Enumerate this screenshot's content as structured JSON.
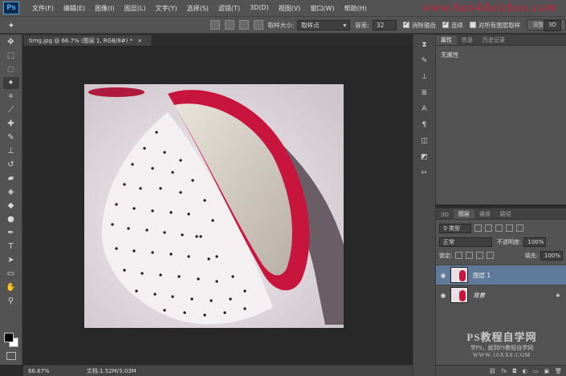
{
  "app": {
    "logo": "Ps"
  },
  "menu": [
    "文件(F)",
    "编辑(E)",
    "图像(I)",
    "图层(L)",
    "文字(Y)",
    "选择(S)",
    "滤镜(T)",
    "3D(D)",
    "视图(V)",
    "窗口(W)",
    "帮助(H)"
  ],
  "watermark_top": "www.hao4daizhuo.com",
  "options": {
    "sample_size_label": "取样大小:",
    "sample_size_value": "取样点",
    "tolerance_label": "容差:",
    "tolerance_value": "32",
    "antialias_label": "消除锯齿",
    "contiguous_label": "连续",
    "all_layers_label": "对所有图层取样",
    "refine_edge_label": "调整边缘...",
    "workspace_label": "3D"
  },
  "document": {
    "tab_title": "timg.jpg @ 66.7% (图层 1, RGB/8#) *"
  },
  "status": {
    "zoom": "66.67%",
    "doc_info": "文档:1.52M/3.03M"
  },
  "properties_panel": {
    "tabs": [
      "属性",
      "信息",
      "历史记录"
    ],
    "empty_text": "无属性"
  },
  "layers_panel": {
    "tabs": [
      "3D",
      "图层",
      "通道",
      "路径"
    ],
    "filter_label": "类型",
    "blend_mode": "正常",
    "opacity_label": "不透明度:",
    "opacity_value": "100%",
    "lock_label": "锁定:",
    "fill_label": "填充:",
    "fill_value": "100%",
    "layers": [
      {
        "name": "图层 1",
        "selected": true
      },
      {
        "name": "背景",
        "locked": true
      }
    ]
  },
  "watermark_bottom": {
    "line1": "PS教程自学网",
    "line2": "学PS，就到PS教程自学网",
    "line3": "WWW.16XX8.COM"
  }
}
